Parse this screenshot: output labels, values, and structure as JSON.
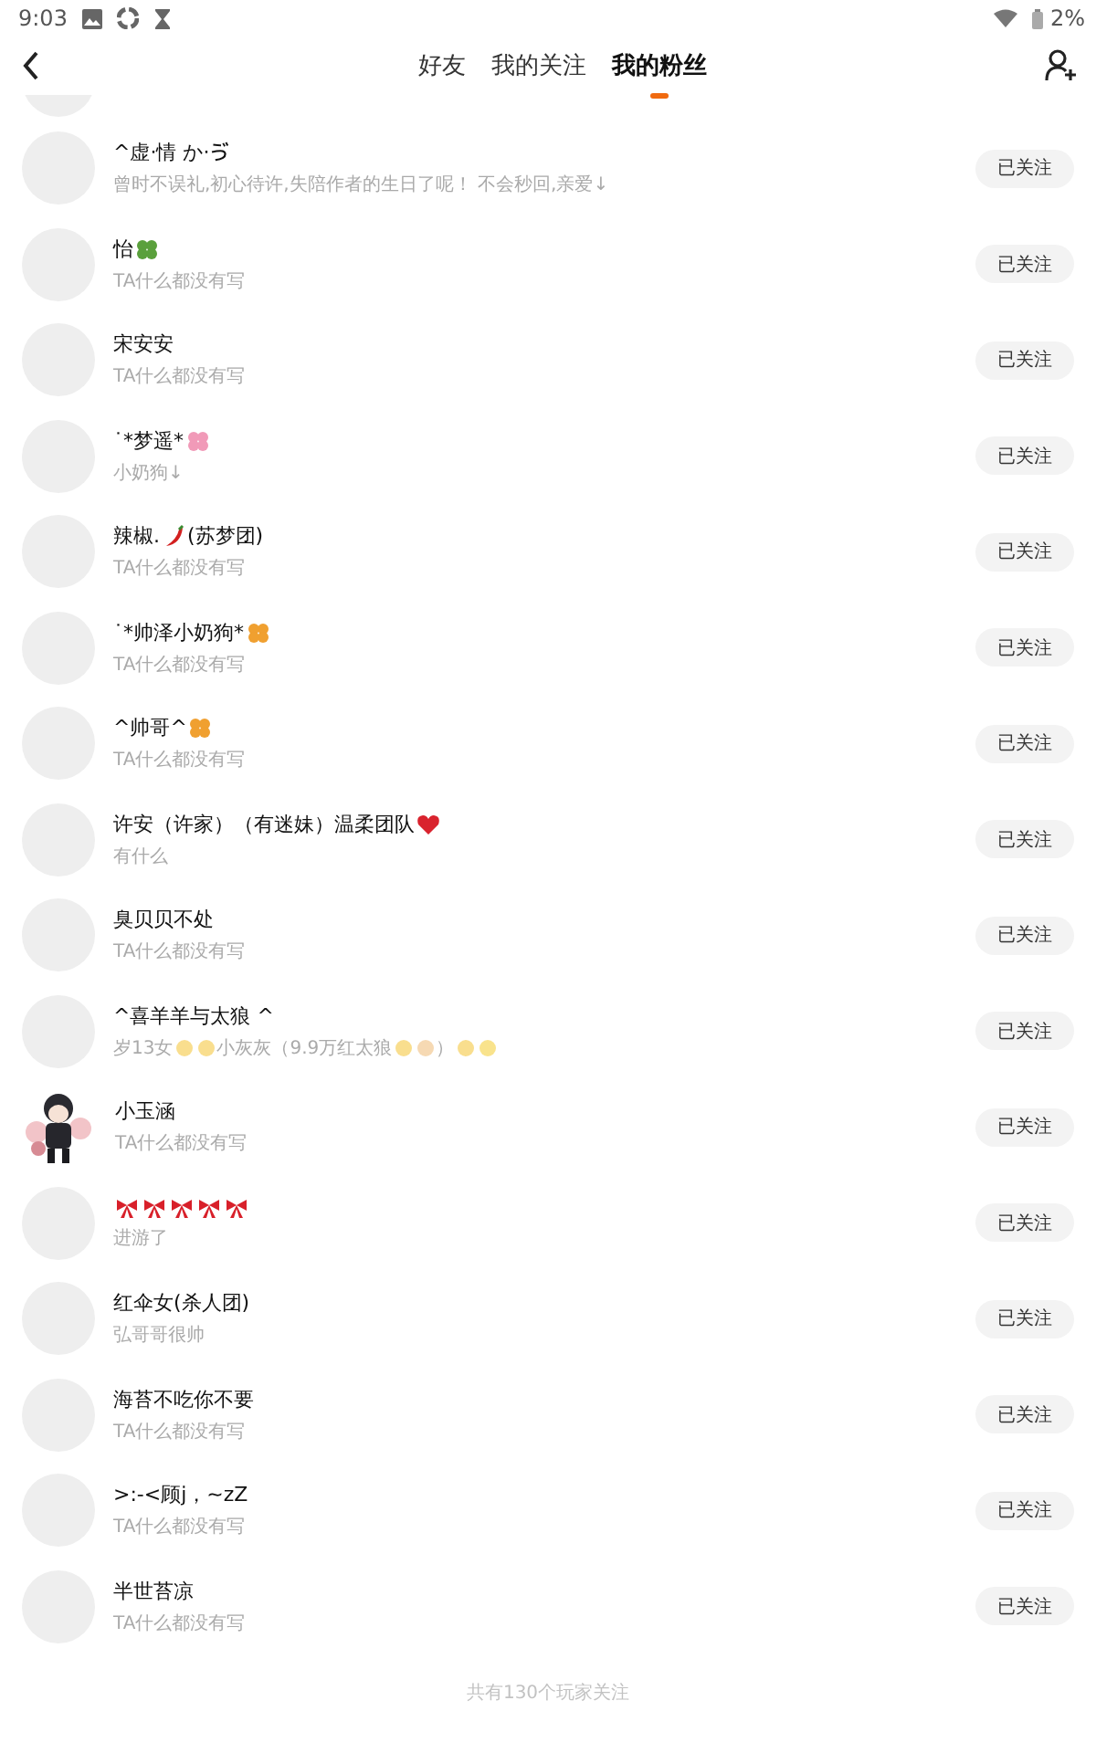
{
  "status_bar": {
    "time": "9:03",
    "battery": "2%"
  },
  "tabs": [
    {
      "label": "好友",
      "selected": false
    },
    {
      "label": "我的关注",
      "selected": false
    },
    {
      "label": "我的粉丝",
      "selected": true
    }
  ],
  "fans": [
    {
      "name": [
        {
          "text": "^虚·情 か·ゔ"
        }
      ],
      "bio": [
        {
          "text": "曾时不误礼,初心待许,失陪作者的生日了呢！ 不会秒回,亲爱↓"
        }
      ],
      "button": "已关注"
    },
    {
      "name": [
        {
          "text": "怡"
        },
        {
          "kind": "clover"
        }
      ],
      "bio": [
        {
          "text": "TA什么都没有写"
        }
      ],
      "button": "已关注"
    },
    {
      "name": [
        {
          "text": "宋安安"
        }
      ],
      "bio": [
        {
          "text": "TA什么都没有写"
        }
      ],
      "button": "已关注"
    },
    {
      "name": [
        {
          "text": "˙*梦遥*"
        },
        {
          "kind": "flower"
        }
      ],
      "bio": [
        {
          "text": "小奶狗↓"
        }
      ],
      "button": "已关注"
    },
    {
      "name": [
        {
          "text": "辣椒."
        },
        {
          "kind": "chili"
        },
        {
          "text": "(苏梦团)"
        }
      ],
      "bio": [
        {
          "text": "TA什么都没有写"
        }
      ],
      "button": "已关注"
    },
    {
      "name": [
        {
          "text": "˙*帅泽小奶狗*"
        },
        {
          "kind": "leaf"
        }
      ],
      "bio": [
        {
          "text": "TA什么都没有写"
        }
      ],
      "button": "已关注"
    },
    {
      "name": [
        {
          "text": "^帅哥^"
        },
        {
          "kind": "leaf"
        }
      ],
      "bio": [
        {
          "text": "TA什么都没有写"
        }
      ],
      "button": "已关注"
    },
    {
      "name": [
        {
          "text": "许安（许家）（有迷妹）温柔团队"
        },
        {
          "kind": "heart"
        }
      ],
      "bio": [
        {
          "text": "有什么"
        }
      ],
      "button": "已关注"
    },
    {
      "name": [
        {
          "text": "臭贝贝不处"
        }
      ],
      "bio": [
        {
          "text": "TA什么都没有写"
        }
      ],
      "button": "已关注"
    },
    {
      "name": [
        {
          "text": "^喜羊羊与太狼 ^"
        }
      ],
      "bio": [
        {
          "text": "岁13女"
        },
        {
          "kind": "smile"
        },
        {
          "kind": "point"
        },
        {
          "text": " 小灰灰（9.9万红太狼"
        },
        {
          "kind": "cry"
        },
        {
          "kind": "pray"
        },
        {
          "text": "）"
        },
        {
          "kind": "smile"
        },
        {
          "kind": "sparkle"
        }
      ],
      "button": "已关注"
    },
    {
      "avatar": {
        "kind": "picture"
      },
      "name": [
        {
          "text": "小玉涵"
        }
      ],
      "bio": [
        {
          "text": "TA什么都没有写"
        }
      ],
      "button": "已关注"
    },
    {
      "name": [
        {
          "kind": "bow"
        },
        {
          "kind": "bow"
        },
        {
          "kind": "bow"
        },
        {
          "kind": "bow"
        },
        {
          "kind": "bow"
        }
      ],
      "bio": [
        {
          "text": "进游了"
        }
      ],
      "button": "已关注"
    },
    {
      "name": [
        {
          "text": "红伞女(杀人团)"
        }
      ],
      "bio": [
        {
          "text": "弘哥哥很帅"
        }
      ],
      "button": "已关注"
    },
    {
      "name": [
        {
          "text": "海苔不吃你不要"
        }
      ],
      "bio": [
        {
          "text": "TA什么都没有写"
        }
      ],
      "button": "已关注"
    },
    {
      "name": [
        {
          "text": ">:-<顾j，~zZ"
        }
      ],
      "bio": [
        {
          "text": "TA什么都没有写"
        }
      ],
      "button": "已关注"
    },
    {
      "name": [
        {
          "text": "半世苔凉"
        }
      ],
      "bio": [
        {
          "text": "TA什么都没有写"
        }
      ],
      "button": "已关注"
    }
  ],
  "footer": "共有130个玩家关注"
}
